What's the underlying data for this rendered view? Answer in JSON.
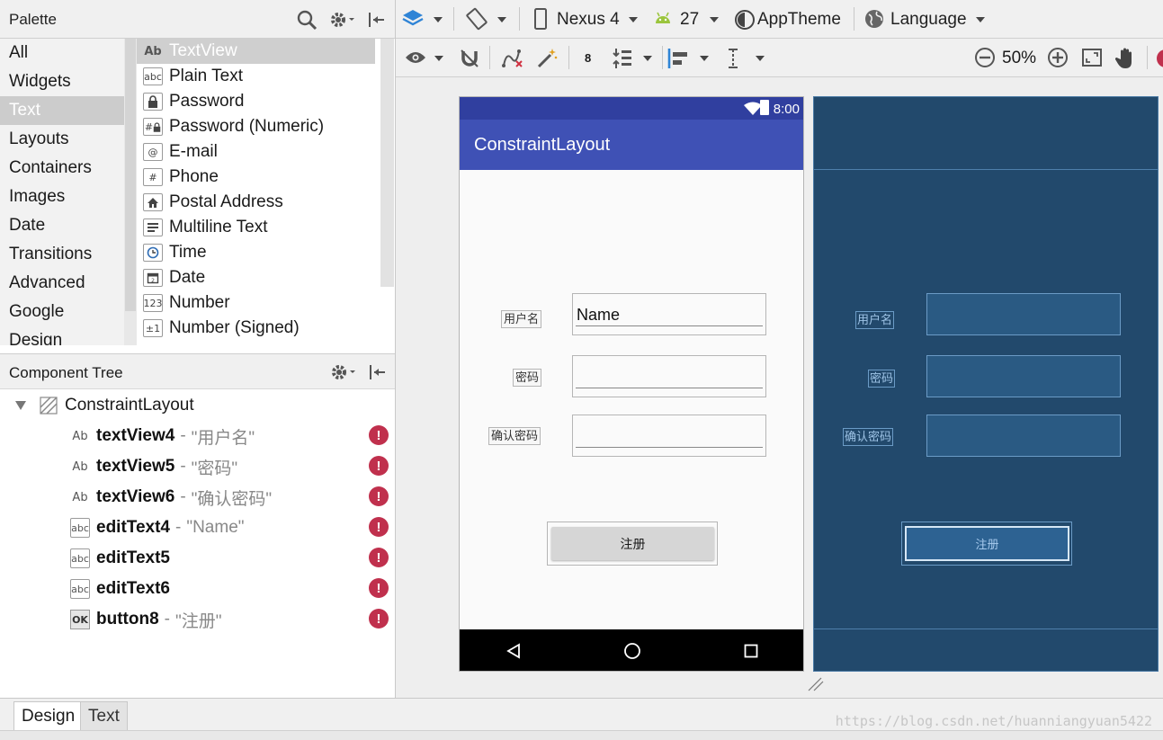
{
  "palette": {
    "title": "Palette",
    "categories": [
      "All",
      "Widgets",
      "Text",
      "Layouts",
      "Containers",
      "Images",
      "Date",
      "Transitions",
      "Advanced",
      "Google",
      "Design"
    ],
    "selected_category": "Text",
    "items": [
      {
        "label": "TextView",
        "icon": "Ab"
      },
      {
        "label": "Plain Text",
        "icon": "abc"
      },
      {
        "label": "Password",
        "icon": "lock"
      },
      {
        "label": "Password (Numeric)",
        "icon": "#lock"
      },
      {
        "label": "E-mail",
        "icon": "@"
      },
      {
        "label": "Phone",
        "icon": "#"
      },
      {
        "label": "Postal Address",
        "icon": "home"
      },
      {
        "label": "Multiline Text",
        "icon": "lines"
      },
      {
        "label": "Time",
        "icon": "clock"
      },
      {
        "label": "Date",
        "icon": "calendar"
      },
      {
        "label": "Number",
        "icon": "123"
      },
      {
        "label": "Number (Signed)",
        "icon": "±1"
      }
    ],
    "selected_item": "TextView"
  },
  "toolbar": {
    "device": "Nexus 4",
    "api": "27",
    "theme": "AppTheme",
    "language": "Language",
    "margin": "8",
    "zoom": "50%"
  },
  "tree": {
    "title": "Component Tree",
    "root": "ConstraintLayout",
    "rows": [
      {
        "icon": "Ab",
        "name": "textView4",
        "sep": "-",
        "value": "\"用户名\""
      },
      {
        "icon": "Ab",
        "name": "textView5",
        "sep": "-",
        "value": "\"密码\""
      },
      {
        "icon": "Ab",
        "name": "textView6",
        "sep": "-",
        "value": "\"确认密码\""
      },
      {
        "icon": "abc",
        "name": "editText4",
        "sep": "-",
        "value": "\"Name\""
      },
      {
        "icon": "abc",
        "name": "editText5",
        "sep": "",
        "value": ""
      },
      {
        "icon": "abc",
        "name": "editText6",
        "sep": "",
        "value": ""
      },
      {
        "icon": "OK",
        "name": "button8",
        "sep": "-",
        "value": "\"注册\""
      }
    ],
    "error_glyph": "!"
  },
  "design": {
    "status_time": "8:00",
    "app_title": "ConstraintLayout",
    "label_username": "用户名",
    "label_password": "密码",
    "label_confirm": "确认密码",
    "edit_name_value": "Name",
    "button_label": "注册"
  },
  "bottom": {
    "tab_design": "Design",
    "tab_text": "Text",
    "watermark": "https://blog.csdn.net/huanniangyuan5422"
  },
  "colors": {
    "primary": "#3f51b5",
    "primary_dark": "#303f9f",
    "blueprint": "#22496c",
    "error": "#c0304d"
  }
}
